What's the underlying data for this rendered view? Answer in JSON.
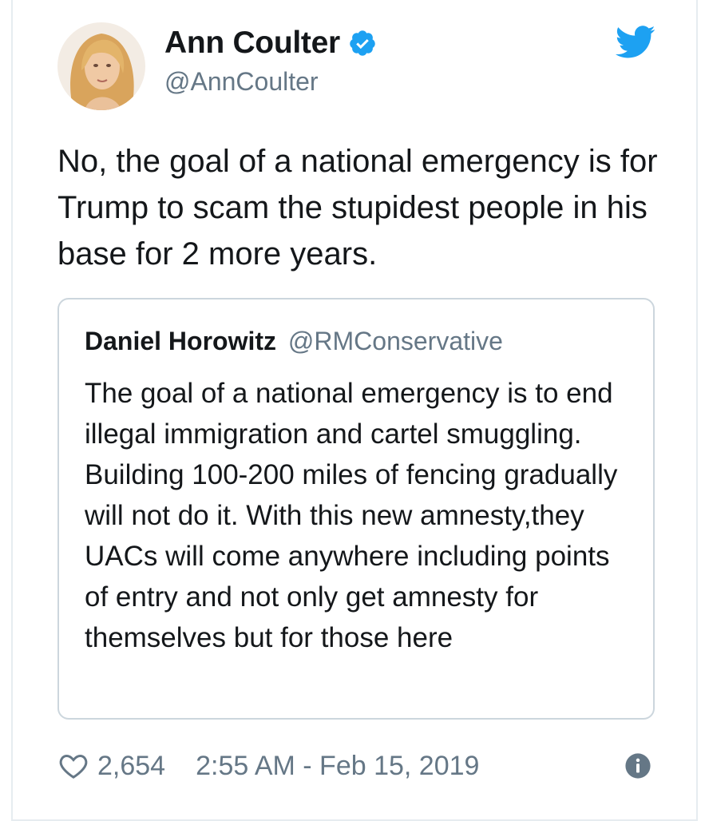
{
  "author": {
    "display_name": "Ann Coulter",
    "handle": "@AnnCoulter",
    "verified": true
  },
  "tweet": {
    "text": "No, the goal of a national emergency is for Trump to scam the stupidest people in his base for 2 more years."
  },
  "quoted_tweet": {
    "display_name": "Daniel Horowitz",
    "handle": "@RMConservative",
    "text": "The goal of a national emergency is to end illegal immigration and cartel smuggling. Building 100-200 miles of fencing gradually will not do it. With this new amnesty,they UACs will come anywhere including points of entry and not only get amnesty for themselves but for those here"
  },
  "footer": {
    "likes": "2,654",
    "timestamp": "2:55 AM - Feb 15, 2019"
  },
  "icons": {
    "verified": "verified-badge-icon",
    "platform": "twitter-bird-icon",
    "like": "heart-icon",
    "info": "info-icon"
  },
  "colors": {
    "brand_blue": "#1da1f2",
    "secondary_text": "#657786",
    "border": "#ccd6dd"
  }
}
